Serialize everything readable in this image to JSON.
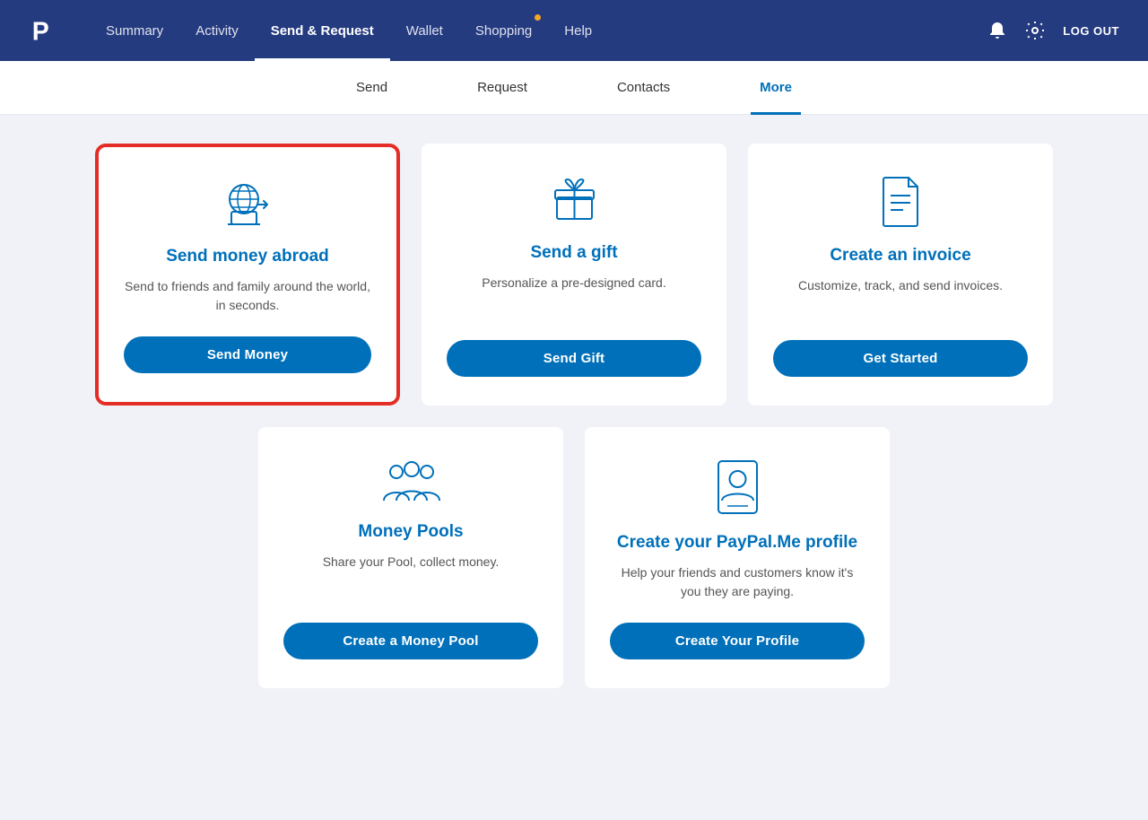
{
  "nav": {
    "links": [
      {
        "label": "Summary",
        "active": false,
        "id": "summary",
        "dot": false
      },
      {
        "label": "Activity",
        "active": false,
        "id": "activity",
        "dot": false
      },
      {
        "label": "Send & Request",
        "active": true,
        "id": "send-request",
        "dot": false
      },
      {
        "label": "Wallet",
        "active": false,
        "id": "wallet",
        "dot": false
      },
      {
        "label": "Shopping",
        "active": false,
        "id": "shopping",
        "dot": true
      },
      {
        "label": "Help",
        "active": false,
        "id": "help",
        "dot": false
      }
    ],
    "logout_label": "LOG OUT"
  },
  "sub_nav": {
    "items": [
      {
        "label": "Send",
        "active": false,
        "id": "send"
      },
      {
        "label": "Request",
        "active": false,
        "id": "request"
      },
      {
        "label": "Contacts",
        "active": false,
        "id": "contacts"
      },
      {
        "label": "More",
        "active": true,
        "id": "more"
      }
    ]
  },
  "cards": [
    {
      "id": "send-money-abroad",
      "highlighted": true,
      "title": "Send money abroad",
      "desc": "Send to friends and family around the world, in seconds.",
      "btn_label": "Send Money"
    },
    {
      "id": "send-a-gift",
      "highlighted": false,
      "title": "Send a gift",
      "desc": "Personalize a pre-designed card.",
      "btn_label": "Send Gift"
    },
    {
      "id": "create-an-invoice",
      "highlighted": false,
      "title": "Create an invoice",
      "desc": "Customize, track, and send invoices.",
      "btn_label": "Get Started"
    }
  ],
  "cards_bottom": [
    {
      "id": "money-pools",
      "title": "Money Pools",
      "desc": "Share your Pool, collect money.",
      "btn_label": "Create a Money Pool"
    },
    {
      "id": "paypal-me",
      "title": "Create your PayPal.Me profile",
      "desc": "Help your friends and customers know it's you they are paying.",
      "btn_label": "Create Your Profile"
    }
  ]
}
